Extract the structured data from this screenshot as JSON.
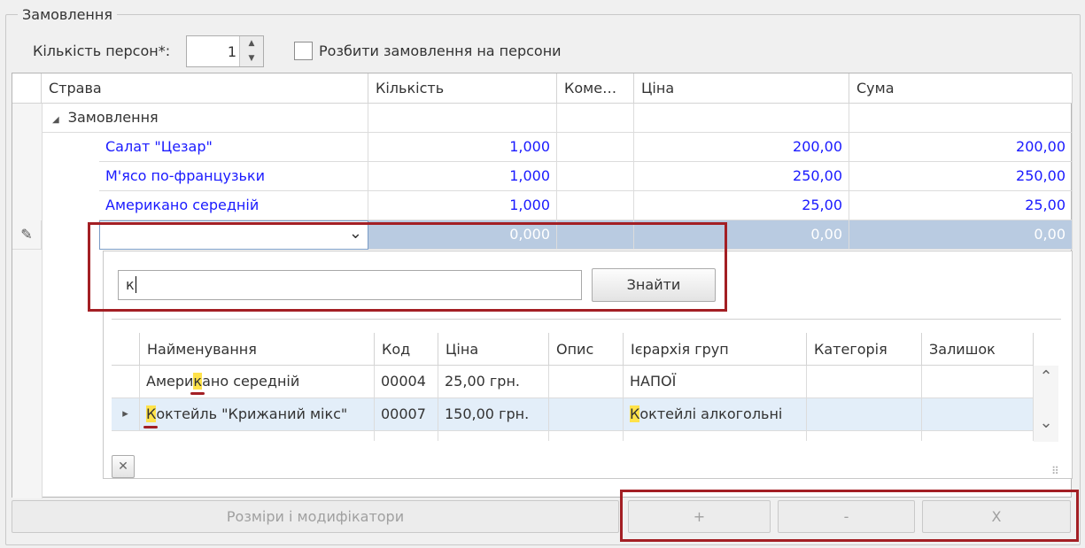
{
  "group_title": "Замовлення",
  "persons": {
    "label": "Кількість персон*:",
    "value": "1",
    "up": "▲",
    "down": "▼"
  },
  "split_checkbox_label": "Розбити замовлення на персони",
  "grid": {
    "columns": [
      "Страва",
      "Кількість",
      "Коме…",
      "Ціна",
      "Сума"
    ],
    "group_row": "Замовлення",
    "expand_glyph": "◢",
    "rows": [
      {
        "dish": "Салат \"Цезар\"",
        "qty": "1,000",
        "comment": "",
        "price": "200,00",
        "sum": "200,00"
      },
      {
        "dish": "М'ясо по-французьки",
        "qty": "1,000",
        "comment": "",
        "price": "250,00",
        "sum": "250,00"
      },
      {
        "dish": "Американо середній",
        "qty": "1,000",
        "comment": "",
        "price": "25,00",
        "sum": "25,00"
      }
    ],
    "edit_row": {
      "qty": "0,000",
      "price": "0,00",
      "sum": "0,00"
    },
    "edit_indicator": "✎",
    "dropdown_glyph": "⌄"
  },
  "popup": {
    "search_value": "к",
    "find_button": "Знайти",
    "columns": [
      "Найменування",
      "Код",
      "Ціна",
      "Опис",
      "Ієрархія груп",
      "Категорія",
      "Залишок"
    ],
    "rows": [
      {
        "name_pre": "Амери",
        "name_hl": "к",
        "name_post": "ано середній",
        "code": "00004",
        "price": "25,00 грн.",
        "desc": "",
        "group_pre": "НАПОЇ",
        "group_hl": "",
        "group_post": "",
        "category": "",
        "stock": ""
      },
      {
        "name_pre": "",
        "name_hl": "К",
        "name_post": "октейль \"Крижаний мікс\"",
        "code": "00007",
        "price": "150,00 грн.",
        "desc": "",
        "group_pre": "",
        "group_hl": "К",
        "group_post": "октейлі алкогольні",
        "category": "",
        "stock": ""
      }
    ],
    "current_row_glyph": "▸",
    "scroll_up": "⌃",
    "scroll_down": "⌄",
    "close_glyph": "✕",
    "resize_glyph": "⠿"
  },
  "bottom": {
    "modifiers_button": "Розміри і модифікатори",
    "add_button": "+",
    "remove_button": "-",
    "clear_button": "X"
  },
  "colors": {
    "highlight": "#ffe24a",
    "selected_row": "#b9cbe1",
    "dish_text": "#1a1aff",
    "callout_border": "#a31f24"
  }
}
